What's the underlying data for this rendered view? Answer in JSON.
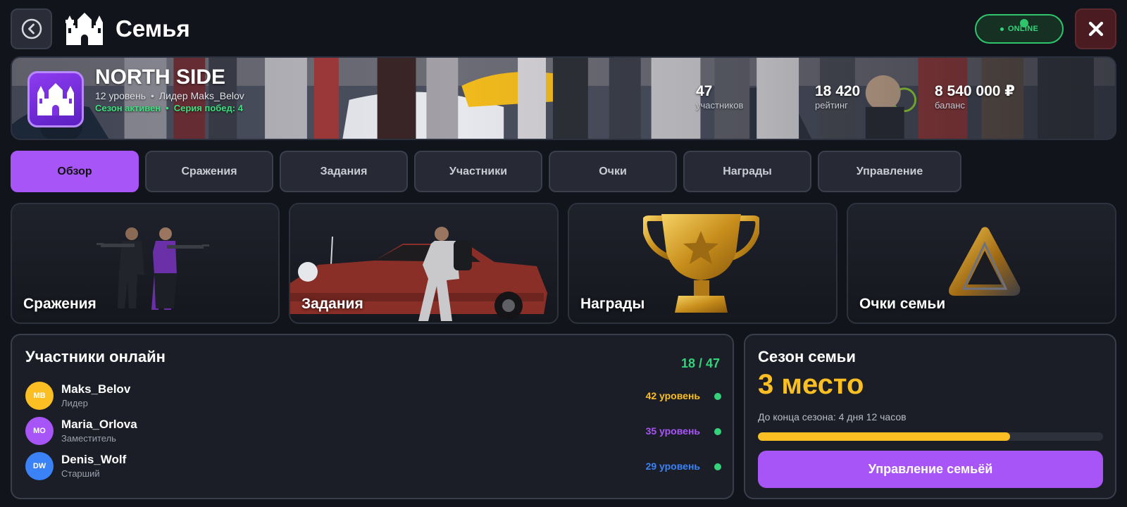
{
  "header": {
    "title": "Семья",
    "online_label": "ONLINE",
    "icons": {
      "back": "back-arrow-icon",
      "app": "castle-icon",
      "close": "close-icon"
    }
  },
  "family": {
    "name": "NORTH SIDE",
    "level": "12 уровень",
    "leader": "Лидер Maks_Belov",
    "season_status": "Сезон активен",
    "win_streak": "Серия побед: 4",
    "stats": [
      {
        "value": "47",
        "label": "участников"
      },
      {
        "value": "18 420",
        "label": "рейтинг"
      },
      {
        "value": "8 540 000 ₽",
        "label": "баланс"
      }
    ]
  },
  "tabs": [
    {
      "label": "Обзор",
      "active": true
    },
    {
      "label": "Сражения",
      "active": false
    },
    {
      "label": "Задания",
      "active": false
    },
    {
      "label": "Участники",
      "active": false
    },
    {
      "label": "Очки",
      "active": false
    },
    {
      "label": "Награды",
      "active": false
    },
    {
      "label": "Управление",
      "active": false
    }
  ],
  "cards": [
    {
      "label": "Сражения",
      "icon": "soldiers-icon"
    },
    {
      "label": "Задания",
      "icon": "car-heist-icon"
    },
    {
      "label": "Награды",
      "icon": "trophy-icon"
    },
    {
      "label": "Очки семьи",
      "icon": "triangle-points-icon"
    }
  ],
  "members_panel": {
    "title": "Участники онлайн",
    "count": "18 / 47",
    "members": [
      {
        "initials": "MB",
        "name": "Maks_Belov",
        "role": "Лидер",
        "level": "42 уровень",
        "color": "#fbbf24"
      },
      {
        "initials": "MO",
        "name": "Maria_Orlova",
        "role": "Заместитель",
        "level": "35 уровень",
        "color": "#a855f7"
      },
      {
        "initials": "DW",
        "name": "Denis_Wolf",
        "role": "Старший",
        "level": "29 уровень",
        "color": "#3b82f6"
      }
    ]
  },
  "season_panel": {
    "title": "Сезон семьи",
    "place": "3 место",
    "time_left": "До конца сезона: 4 дня 12 часов",
    "progress": 0.73,
    "button": "Управление семьёй"
  },
  "colors": {
    "accent": "#a855f7",
    "online": "#34d27a",
    "gold": "#fbbf24",
    "background": "#12141b"
  }
}
